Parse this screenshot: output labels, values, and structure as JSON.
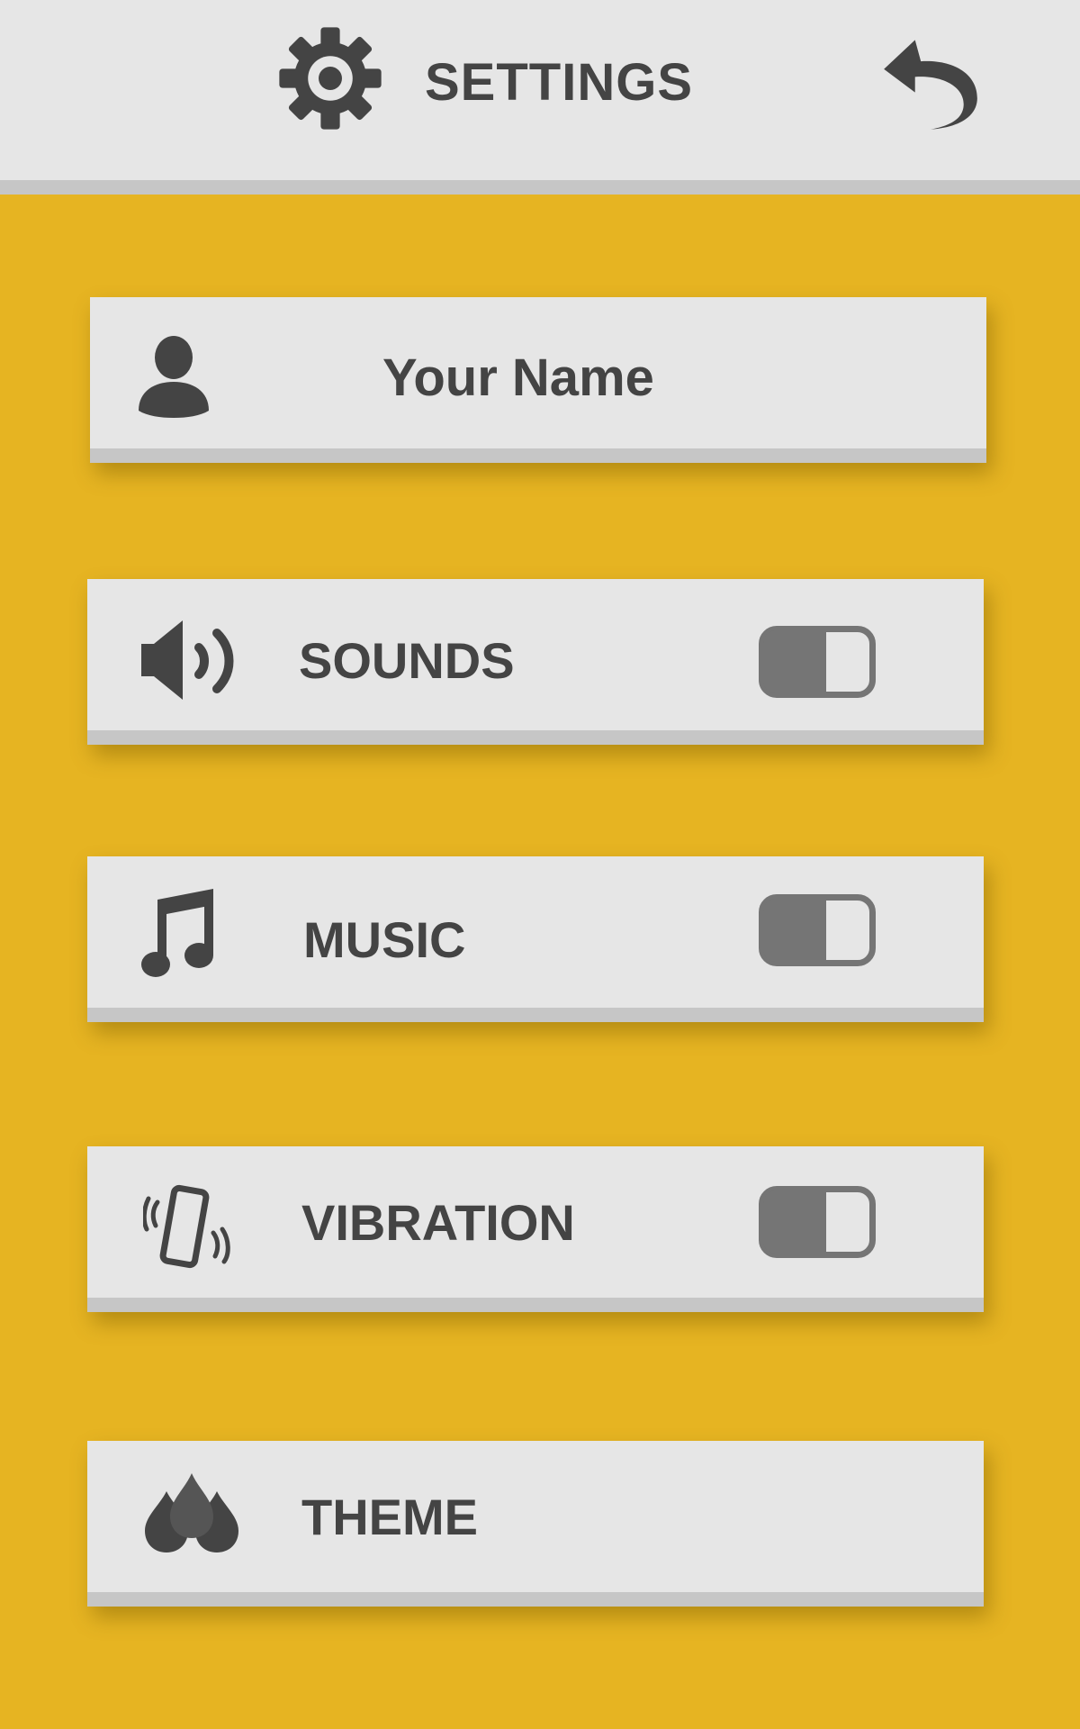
{
  "header": {
    "title": "SETTINGS",
    "settings_icon": "gear-icon",
    "back_icon": "back-arrow-icon"
  },
  "profile": {
    "name": "Your Name",
    "icon": "user-icon"
  },
  "settings": [
    {
      "label": "SOUNDS",
      "icon": "speaker-icon",
      "toggle": "on"
    },
    {
      "label": "MUSIC",
      "icon": "music-note-icon",
      "toggle": "on"
    },
    {
      "label": "VIBRATION",
      "icon": "vibrating-phone-icon",
      "toggle": "on"
    },
    {
      "label": "THEME",
      "icon": "drops-icon"
    }
  ],
  "colors": {
    "background": "#e6b422",
    "card": "#e6e6e6",
    "card_stripe": "#c6c6c6",
    "text": "#444444",
    "toggle": "#757575"
  }
}
